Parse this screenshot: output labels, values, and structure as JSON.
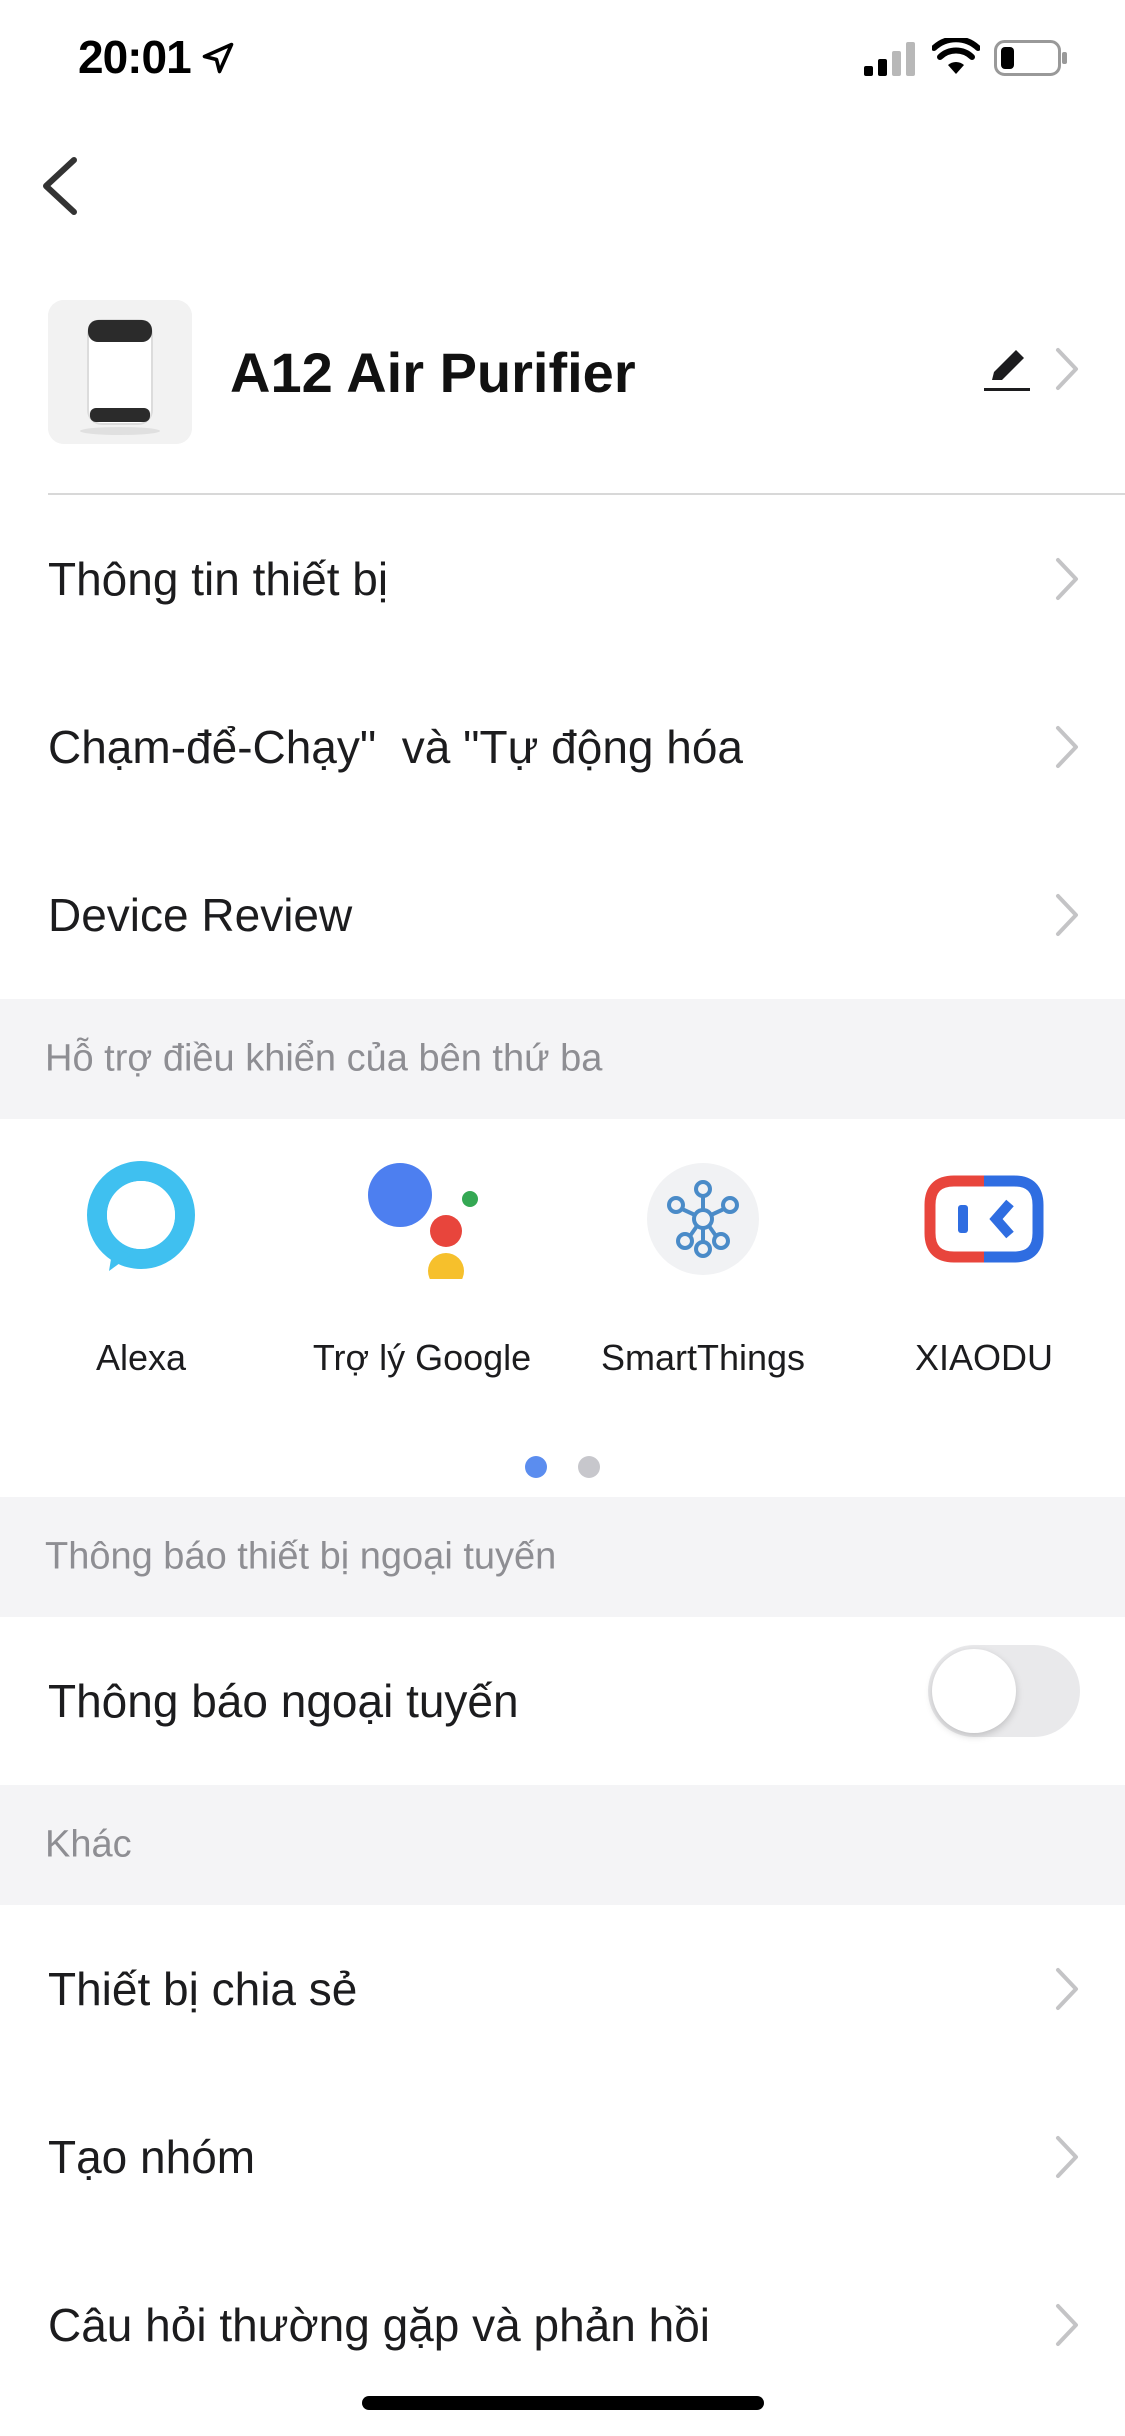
{
  "status_bar": {
    "time": "20:01"
  },
  "device": {
    "name": "A12 Air Purifier"
  },
  "menu_top": [
    {
      "label": "Thông tin thiết bị"
    },
    {
      "label": "Chạm-để-Chạy\"  và \"Tự động hóa"
    },
    {
      "label": "Device Review"
    }
  ],
  "third_party": {
    "title": "Hỗ trợ điều khiển của bên thứ ba",
    "items": [
      {
        "label": "Alexa",
        "icon": "alexa-icon"
      },
      {
        "label": "Trợ lý Google",
        "icon": "google-assistant-icon"
      },
      {
        "label": "SmartThings",
        "icon": "smartthings-icon"
      },
      {
        "label": "XIAODU",
        "icon": "xiaodu-icon"
      }
    ],
    "page_count": 2,
    "active_page": 1
  },
  "offline": {
    "title": "Thông báo thiết bị ngoại tuyến",
    "toggle_label": "Thông báo ngoại tuyến",
    "toggle_on": false
  },
  "other": {
    "title": "Khác",
    "items": [
      {
        "label": "Thiết bị chia sẻ"
      },
      {
        "label": "Tạo nhóm"
      },
      {
        "label": "Câu hỏi thường gặp và phản hồi"
      }
    ]
  },
  "colors": {
    "section_bg": "#f4f4f6",
    "section_text": "#8e8e93",
    "dot_active": "#5b8def",
    "dot_inactive": "#c7c7cc",
    "alexa": "#3fc0f0",
    "xiaodu_red": "#e8453c",
    "xiaodu_blue": "#2f6de1"
  }
}
